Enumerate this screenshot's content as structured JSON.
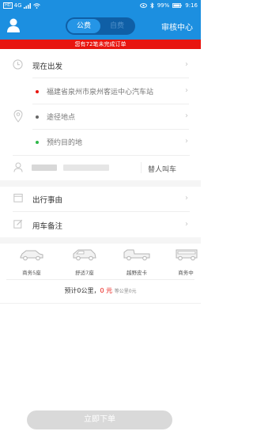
{
  "status_bar": {
    "hd": "HD",
    "network": "4G",
    "battery": "99%",
    "time": "9:16"
  },
  "header": {
    "tab_active": "公费",
    "tab_inactive": "自费",
    "audit_label": "审核中心"
  },
  "banner": {
    "text": "您有72笔未完成订单"
  },
  "trip": {
    "depart": "现在出发",
    "origin": "福建省泉州市泉州客运中心汽车站",
    "waypoint": "途径地点",
    "destination": "预约目的地",
    "call_for_other": "替人叫车"
  },
  "reason": {
    "label": "出行事由"
  },
  "remark": {
    "label": "用车备注"
  },
  "vehicles": [
    {
      "label": "商务5座",
      "icon": "sedan-icon"
    },
    {
      "label": "舒适7座",
      "icon": "mpv-icon"
    },
    {
      "label": "越野皮卡",
      "icon": "pickup-icon"
    },
    {
      "label": "商务中",
      "icon": "van-icon"
    }
  ],
  "estimate": {
    "prefix": "预计0公里，",
    "price": "0 元",
    "extra": "等公里0元"
  },
  "submit_label": "立即下单",
  "colors": {
    "primary": "#1c8fe0",
    "banner": "#e8150f",
    "origin_dot": "#e8150f",
    "waypoint_dot": "#666666",
    "destination_dot": "#2fb84a"
  }
}
